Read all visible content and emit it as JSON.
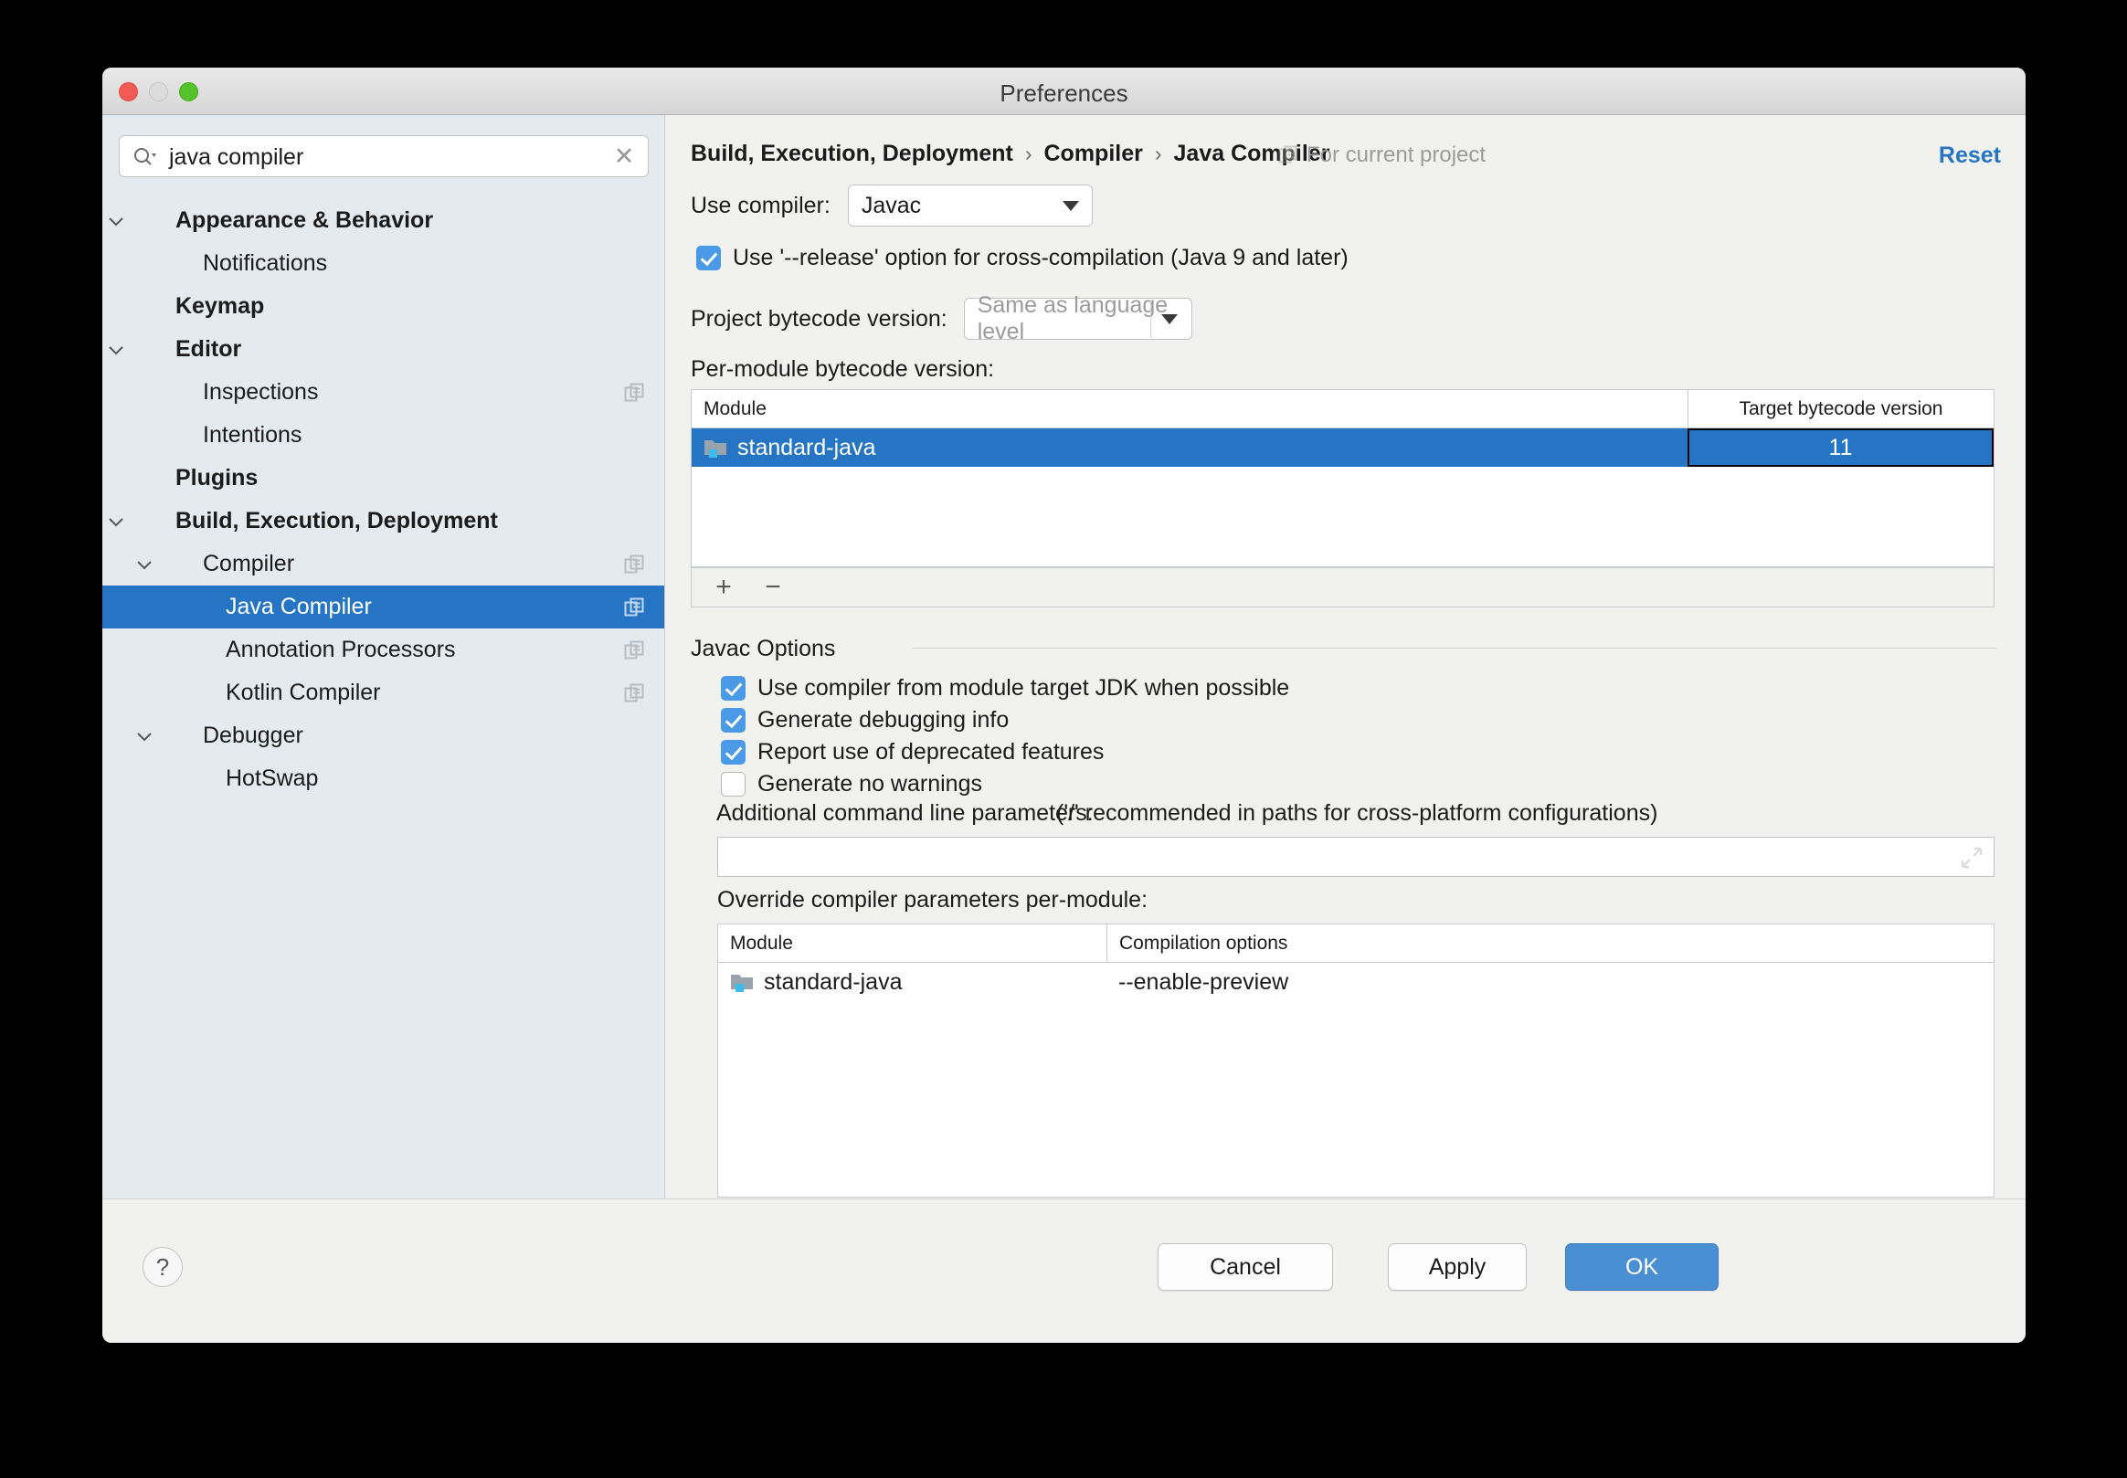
{
  "window": {
    "title": "Preferences",
    "traffic_lights": [
      "close-button",
      "minimize-button",
      "zoom-button"
    ]
  },
  "search": {
    "value": "java compiler",
    "placeholder": "Search",
    "icon": "search-icon",
    "clear_icon": "clear-icon"
  },
  "sidebar": {
    "items": [
      {
        "label": "Appearance & Behavior",
        "indent": 0,
        "bold": true,
        "twisty": "chevron-down-icon",
        "copy": false,
        "selected": false
      },
      {
        "label": "Notifications",
        "indent": 1,
        "bold": false,
        "twisty": "",
        "copy": false,
        "selected": false
      },
      {
        "label": "Keymap",
        "indent": 0,
        "bold": true,
        "twisty": "",
        "copy": false,
        "selected": false
      },
      {
        "label": "Editor",
        "indent": 0,
        "bold": true,
        "twisty": "chevron-down-icon",
        "copy": false,
        "selected": false
      },
      {
        "label": "Inspections",
        "indent": 1,
        "bold": false,
        "twisty": "",
        "copy": true,
        "selected": false
      },
      {
        "label": "Intentions",
        "indent": 1,
        "bold": false,
        "twisty": "",
        "copy": false,
        "selected": false
      },
      {
        "label": "Plugins",
        "indent": 0,
        "bold": true,
        "twisty": "",
        "copy": false,
        "selected": false
      },
      {
        "label": "Build, Execution, Deployment",
        "indent": 0,
        "bold": true,
        "twisty": "chevron-down-icon",
        "copy": false,
        "selected": false
      },
      {
        "label": "Compiler",
        "indent": 1,
        "bold": false,
        "twisty": "chevron-down-icon",
        "copy": true,
        "selected": false
      },
      {
        "label": "Java Compiler",
        "indent": 2,
        "bold": false,
        "twisty": "",
        "copy": true,
        "selected": true
      },
      {
        "label": "Annotation Processors",
        "indent": 2,
        "bold": false,
        "twisty": "",
        "copy": true,
        "selected": false
      },
      {
        "label": "Kotlin Compiler",
        "indent": 2,
        "bold": false,
        "twisty": "",
        "copy": true,
        "selected": false
      },
      {
        "label": "Debugger",
        "indent": 1,
        "bold": false,
        "twisty": "chevron-down-icon",
        "copy": false,
        "selected": false
      },
      {
        "label": "HotSwap",
        "indent": 2,
        "bold": false,
        "twisty": "",
        "copy": false,
        "selected": false
      }
    ]
  },
  "header": {
    "breadcrumb": [
      "Build, Execution, Deployment",
      "Compiler",
      "Java Compiler"
    ],
    "separator": "›",
    "scope_label": "For current project",
    "scope_icon": "copy-icon",
    "reset_label": "Reset"
  },
  "main": {
    "use_compiler_label": "Use compiler:",
    "use_compiler_value": "Javac",
    "release_option_label": "Use '--release' option for cross-compilation (Java 9 and later)",
    "release_option_checked": true,
    "project_bytecode_label": "Project bytecode version:",
    "project_bytecode_value": "Same as language level",
    "per_module_label": "Per-module bytecode version:",
    "bytecode_table": {
      "columns": [
        "Module",
        "Target bytecode version"
      ],
      "rows": [
        {
          "module": "standard-java",
          "target": "11",
          "selected": true,
          "icon": "module-icon"
        }
      ],
      "toolbar": {
        "add": "+",
        "remove": "−"
      }
    },
    "javac_section_title": "Javac Options",
    "javac_options": [
      {
        "label": "Use compiler from module target JDK when possible",
        "checked": true
      },
      {
        "label": "Generate debugging info",
        "checked": true
      },
      {
        "label": "Report use of deprecated features",
        "checked": true
      },
      {
        "label": "Generate no warnings",
        "checked": false
      }
    ],
    "additional_params_label": "Additional command line parameters:",
    "additional_params_hint": "('/' recommended in paths for cross-platform configurations)",
    "additional_params_value": "",
    "expand_icon": "expand-icon",
    "override_label": "Override compiler parameters per-module:",
    "override_table": {
      "columns": [
        "Module",
        "Compilation options"
      ],
      "rows": [
        {
          "module": "standard-java",
          "options": "--enable-preview",
          "icon": "module-icon"
        }
      ]
    }
  },
  "footer": {
    "help_label": "?",
    "cancel_label": "Cancel",
    "apply_label": "Apply",
    "ok_label": "OK"
  },
  "colors": {
    "accent": "#2675c4",
    "checkbox": "#4a9ae8",
    "primary_button": "#4a8fd4",
    "sidebar_bg": "#e5eaee",
    "panel_bg": "#f1f1f0"
  }
}
